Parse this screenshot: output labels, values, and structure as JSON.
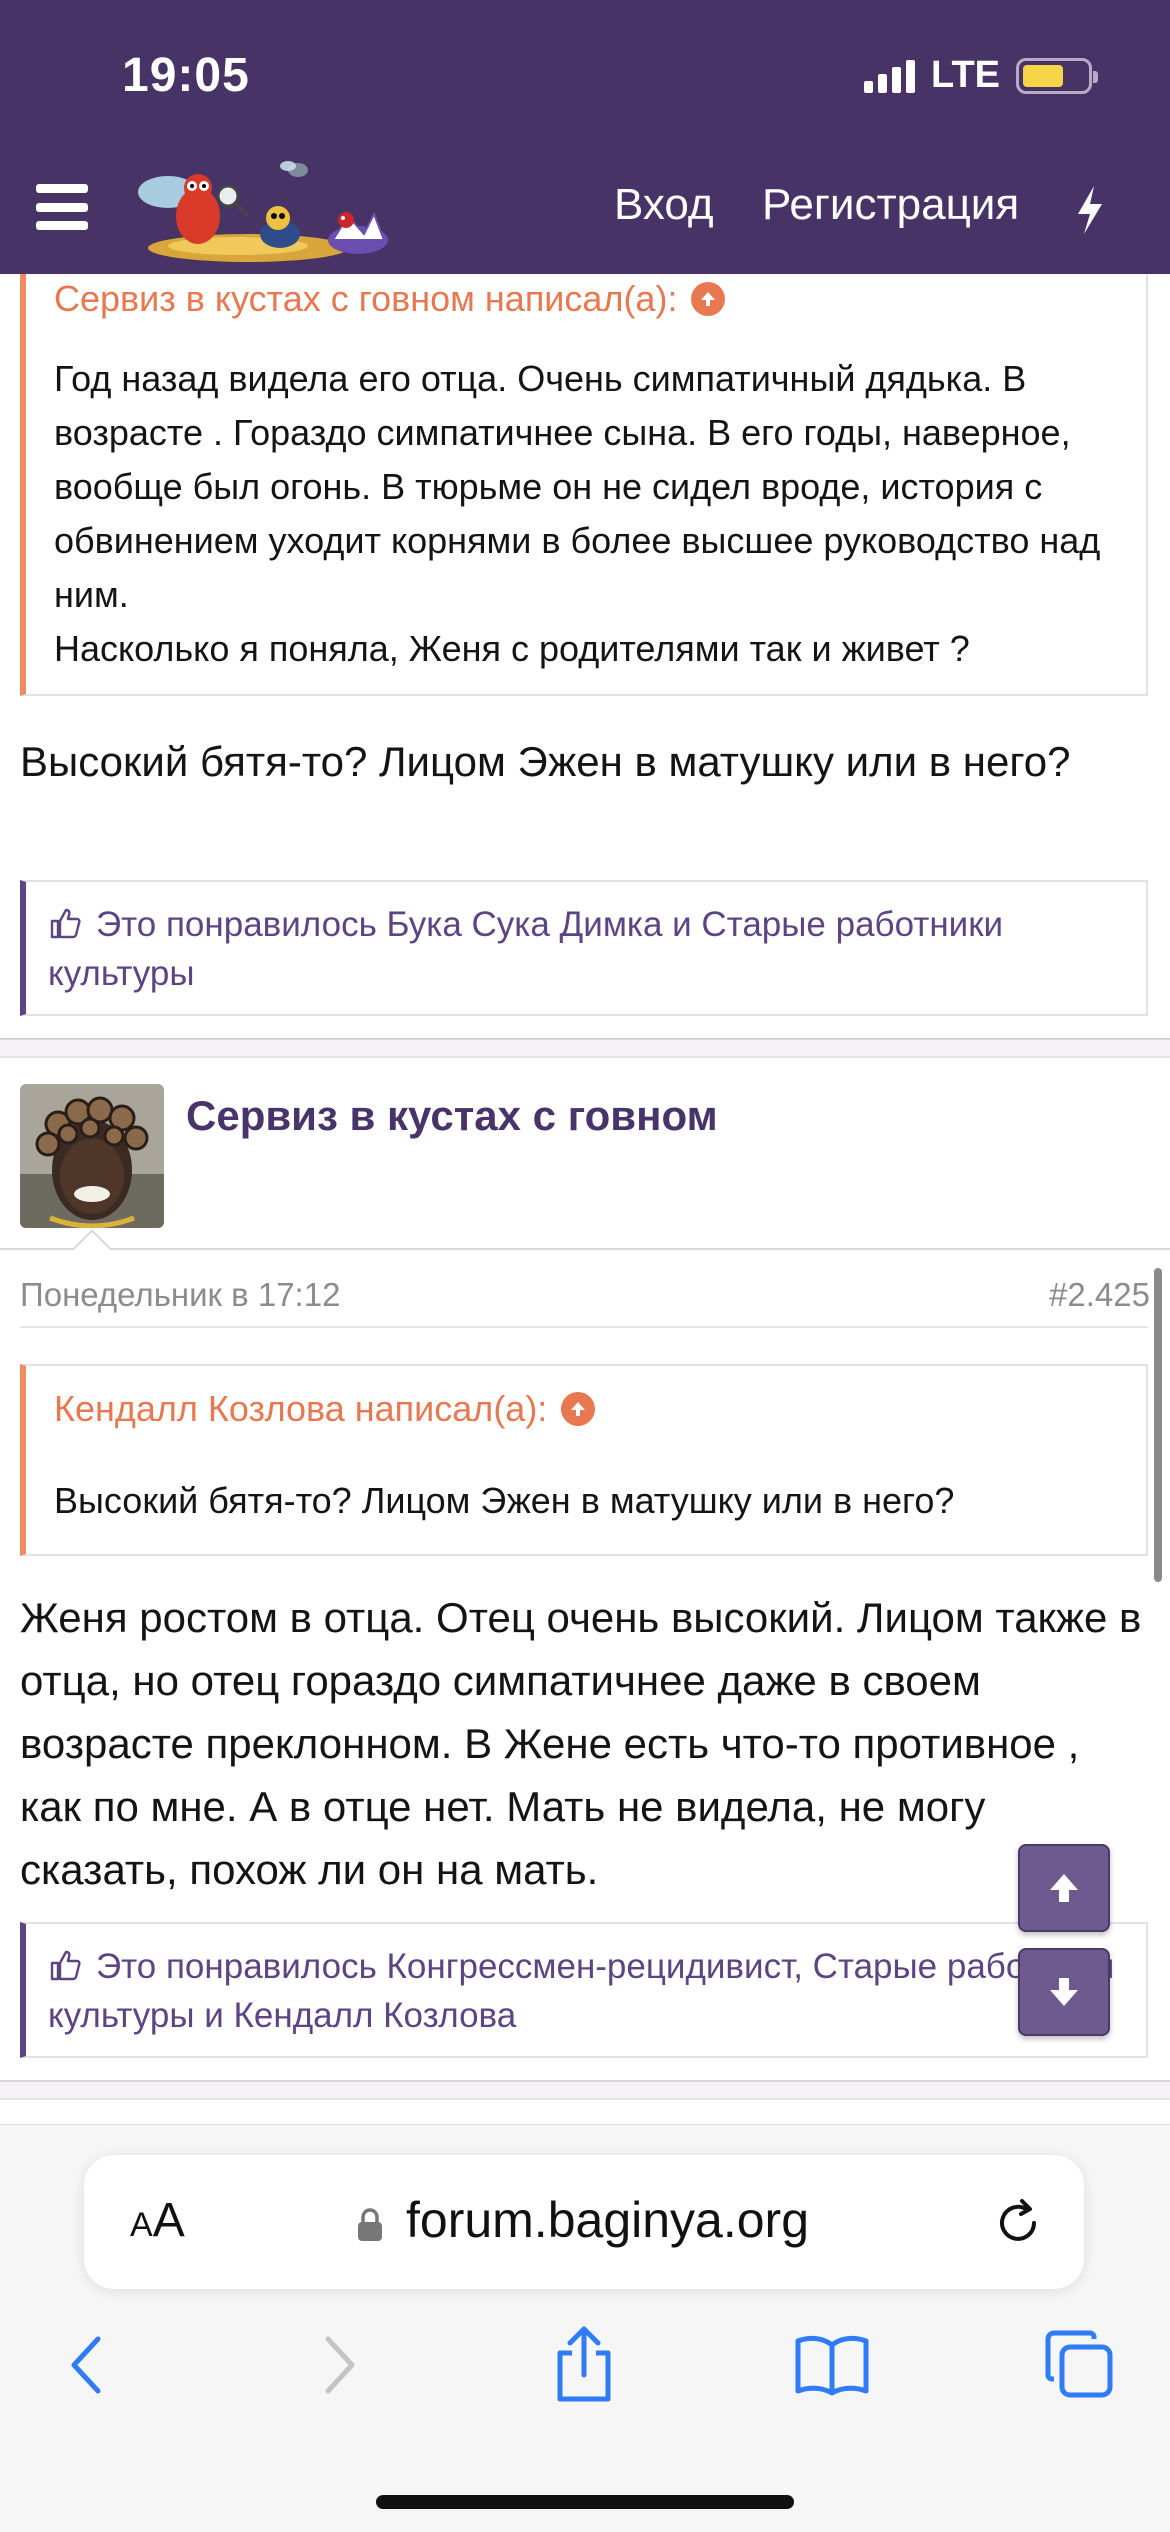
{
  "status_bar": {
    "time": "19:05",
    "network": "LTE"
  },
  "header": {
    "login": "Вход",
    "register": "Регистрация"
  },
  "post1": {
    "quote_author": "Сервиз в кустах с говном написал(а):",
    "quote_text": "Год назад видела его отца. Очень симпатичный дядька. В возрасте . Гораздо симпатичнее сына. В его годы, наверное, вообще был огонь. В тюрьме он не сидел вроде, история с обвинением уходит корнями в более высшее руководство над ним.\nНасколько я поняла, Женя с родителями так и живет ?",
    "message": "Высокий бятя-то? Лицом Эжен в матушку или в него?",
    "likes": "Это понравилось Бука Сука Димка и Старые работники культуры"
  },
  "post2": {
    "author": "Сервиз в кустах с говном",
    "date": "Понедельник в 17:12",
    "number": "#2.425",
    "quote_author": "Кендалл Козлова написал(а):",
    "quote_text": "Высокий бятя-то? Лицом Эжен в матушку или в него?",
    "message": "Женя ростом в отца. Отец очень высокий. Лицом также в отца, но отец гораздо симпатичнее даже в своем возрасте преклонном. В Жене есть что-то противное , как по мне. А в отце нет. Мать не видела, не могу сказать, похож ли он на мать.",
    "likes": "Это понравилось Конгрессмен-рецидивист, Старые работники культуры и Кендалл Козлова"
  },
  "browser": {
    "aa_small": "A",
    "aa_large": "A",
    "url": "forum.baginya.org"
  },
  "colors": {
    "header_bg": "#483366",
    "accent": "#5d4484",
    "quote_accent": "#e8784f"
  }
}
